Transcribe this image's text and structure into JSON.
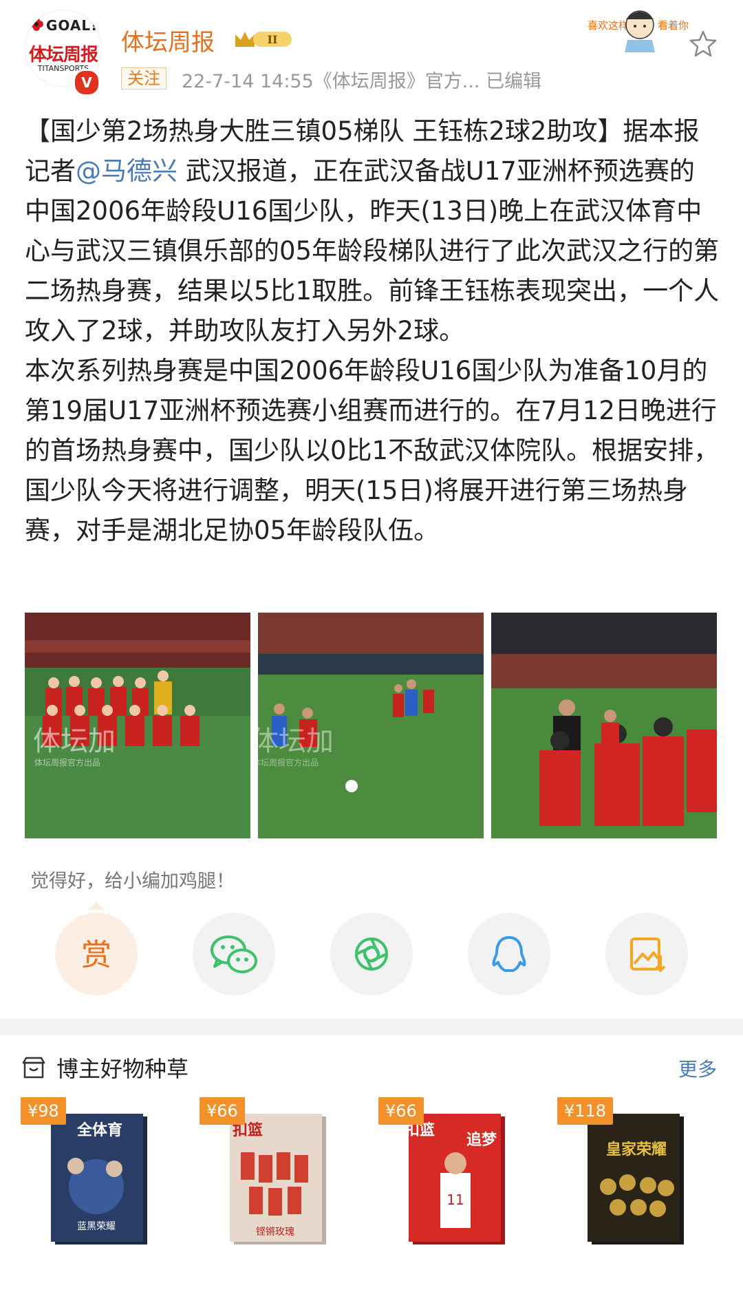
{
  "header": {
    "avatar_goal_text": "GOAL!",
    "avatar_brand_text": "体坛周报",
    "avatar_english_text": "TITANSPORTS",
    "verified_badge": "V",
    "username": "体坛周报",
    "level_badge": "II",
    "follow_label": "关注",
    "meta": "22-7-14 14:55《体坛周报》官方... 已编辑",
    "sticker_text_left": "喜欢这样",
    "sticker_text_right": "看着你"
  },
  "post": {
    "p1_before": "【国少第2场热身大胜三镇05梯队 王钰栋2球2助攻】据本报记者",
    "mention": "@马德兴",
    "p1_after": " 武汉报道，正在武汉备战U17亚洲杯预选赛的中国2006年龄段U16国少队，昨天(13日)晚上在武汉体育中心与武汉三镇俱乐部的05年龄段梯队进行了此次武汉之行的第二场热身赛，结果以5比1取胜。前锋王钰栋表现突出，一个人攻入了2球，并助攻队友打入另外2球。",
    "p2": "本次系列热身赛是中国2006年龄段U16国少队为准备10月的第19届U17亚洲杯预选赛小组赛而进行的。在7月12日晚进行的首场热身赛中，国少队以0比1不敌武汉体院队。根据安排，国少队今天将进行调整，明天(15日)将展开进行第三场热身赛，对手是湖北足协05年龄段队伍。"
  },
  "photos": [
    {
      "watermark": "体坛加",
      "subtitle": "体坛周报官方出品"
    },
    {
      "watermark": "体坛加",
      "subtitle": "体坛周报官方出品"
    },
    {
      "watermark": "",
      "subtitle": ""
    }
  ],
  "reward_tip": "觉得好，给小编加鸡腿！",
  "actions": [
    {
      "name": "reward",
      "label": "赏"
    },
    {
      "name": "wechat"
    },
    {
      "name": "moments"
    },
    {
      "name": "qq"
    },
    {
      "name": "save-image"
    }
  ],
  "shop": {
    "title": "博主好物种草",
    "more_label": "更多",
    "products": [
      {
        "price": "¥98",
        "cover_title": "全体育",
        "cover_sub": "蓝黑荣耀"
      },
      {
        "price": "¥66",
        "cover_title": "扣篮",
        "cover_sub": "铿锵玫瑰"
      },
      {
        "price": "¥66",
        "cover_title": "扣篮",
        "cover_sub": "追梦"
      },
      {
        "price": "¥118",
        "cover_title": "皇家荣耀",
        "cover_sub": ""
      }
    ]
  },
  "colors": {
    "accent_orange": "#e8701a",
    "link_blue": "#4a7bb5",
    "price_orange": "#f2902a",
    "wechat_green": "#3cc26b",
    "qq_blue": "#3a9be6",
    "save_orange": "#f5a623"
  }
}
